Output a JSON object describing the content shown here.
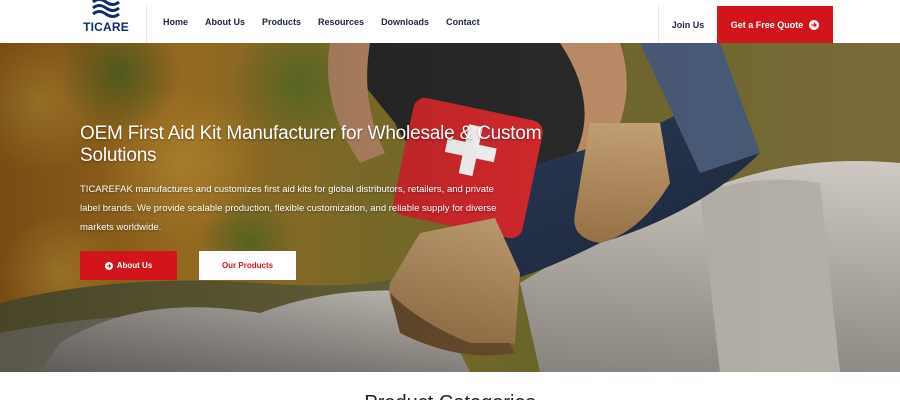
{
  "brand": {
    "name": "TICARE",
    "accent_color": "#d1151b",
    "navy": "#0e2f6b"
  },
  "nav": {
    "items": [
      {
        "label": "Home"
      },
      {
        "label": "About Us"
      },
      {
        "label": "Products"
      },
      {
        "label": "Resources"
      },
      {
        "label": "Downloads"
      },
      {
        "label": "Contact"
      }
    ],
    "join_label": "Join Us",
    "quote_label": "Get a Free Quote",
    "quote_icon": "arrow-right-circle-icon"
  },
  "hero": {
    "title": "OEM First Aid Kit Manufacturer for Wholesale & Custom Solutions",
    "description": "TICAREFAK manufactures and customizes first aid kits for global distributors, retailers, and private label brands. We provide scalable production, flexible customization, and reliable supply for diverse markets worldwide.",
    "about_button": "About Us",
    "about_icon": "arrow-right-circle-icon",
    "products_button": "Our Products"
  },
  "next_section": {
    "title": "Product Categories"
  }
}
